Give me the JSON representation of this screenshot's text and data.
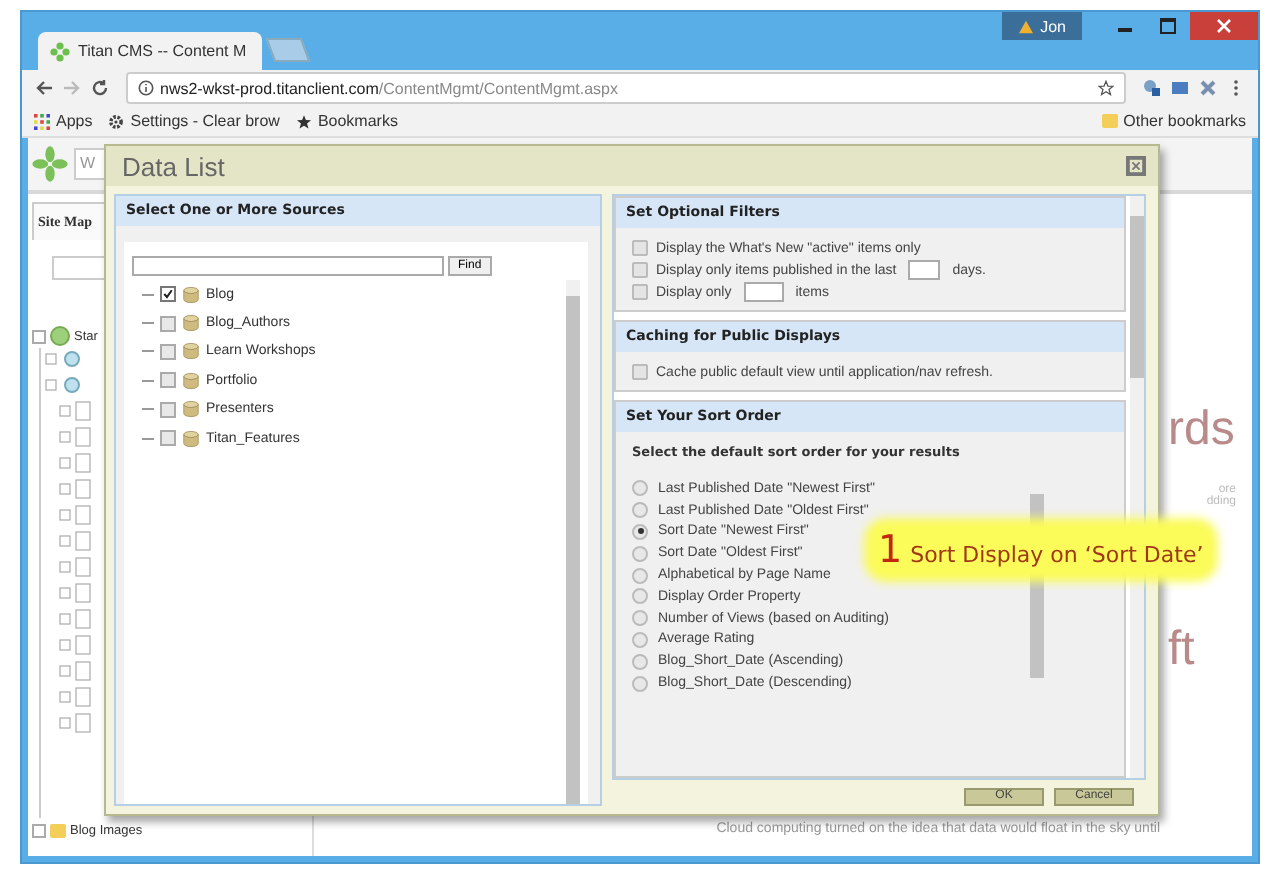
{
  "browser": {
    "tab_title": "Titan CMS -- Content M",
    "user": "Jon",
    "url_host": "nws2-wkst-prod.titanclient.com",
    "url_path": "/ContentMgmt/ContentMgmt.aspx",
    "bookmarks": [
      "Apps",
      "Settings - Clear brow",
      "Bookmarks"
    ],
    "other_bookmarks": "Other bookmarks"
  },
  "page": {
    "search_value": "W",
    "sidebar_tab": "Site Map",
    "tree_top": "Star",
    "tree_bottom": "Blog Images",
    "background_big_1": "rds",
    "background_small": [
      "ore",
      "dding"
    ],
    "background_big_2": "ft",
    "teaser": "Cloud computing turned on the idea that data would float in the sky until"
  },
  "dialog": {
    "title": "Data List",
    "sources": {
      "heading": "Select One or More Sources",
      "find_button": "Find",
      "items": [
        {
          "label": "Blog",
          "checked": true
        },
        {
          "label": "Blog_Authors",
          "checked": false
        },
        {
          "label": "Learn Workshops",
          "checked": false
        },
        {
          "label": "Portfolio",
          "checked": false
        },
        {
          "label": "Presenters",
          "checked": false
        },
        {
          "label": "Titan_Features",
          "checked": false
        }
      ]
    },
    "filters": {
      "heading": "Set Optional Filters",
      "options": [
        {
          "kind": "plain",
          "text": "Display the What's New \"active\" items only",
          "checked": false
        },
        {
          "kind": "input",
          "text": "Display only items published in the last",
          "after": "days.",
          "checked": false
        },
        {
          "kind": "input",
          "text": "Display only",
          "after": "items",
          "checked": false
        }
      ]
    },
    "caching": {
      "heading": "Caching for Public Displays",
      "options": [
        {
          "text": "Cache public default view until application/nav refresh.",
          "checked": false
        }
      ]
    },
    "sort": {
      "heading": "Set Your Sort Order",
      "prompt": "Select the default sort order for your results",
      "options": [
        {
          "label": "Last Published Date \"Newest First\"",
          "selected": false
        },
        {
          "label": "Last Published Date \"Oldest First\"",
          "selected": false
        },
        {
          "label": "Sort Date \"Newest First\"",
          "selected": true
        },
        {
          "label": "Sort Date \"Oldest First\"",
          "selected": false
        },
        {
          "label": "Alphabetical by Page Name",
          "selected": false
        },
        {
          "label": "Display Order Property",
          "selected": false
        },
        {
          "label": "Number of Views (based on Auditing)",
          "selected": false
        },
        {
          "label": "Average Rating",
          "selected": false
        },
        {
          "label": "Blog_Short_Date (Ascending)",
          "selected": false
        },
        {
          "label": "Blog_Short_Date (Descending)",
          "selected": false
        }
      ]
    },
    "buttons": [
      "OK",
      "Cancel"
    ]
  },
  "callout": {
    "number": "1",
    "text": "Sort Display on ‘Sort Date’"
  }
}
